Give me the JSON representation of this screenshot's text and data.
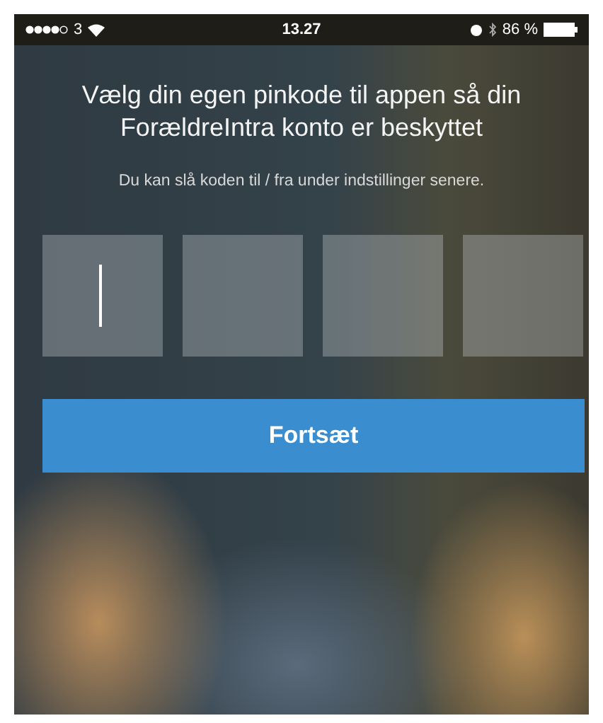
{
  "status_bar": {
    "carrier": "3",
    "time": "13.27",
    "battery": "86 %"
  },
  "heading": "Vælg din egen pinkode til appen så din ForældreIntra konto er beskyttet",
  "subtext": "Du kan slå koden til / fra under indstillinger senere.",
  "pin_fields": [
    {
      "focused": true
    },
    {
      "focused": false
    },
    {
      "focused": false
    },
    {
      "focused": false
    }
  ],
  "button": {
    "label": "Fortsæt"
  }
}
